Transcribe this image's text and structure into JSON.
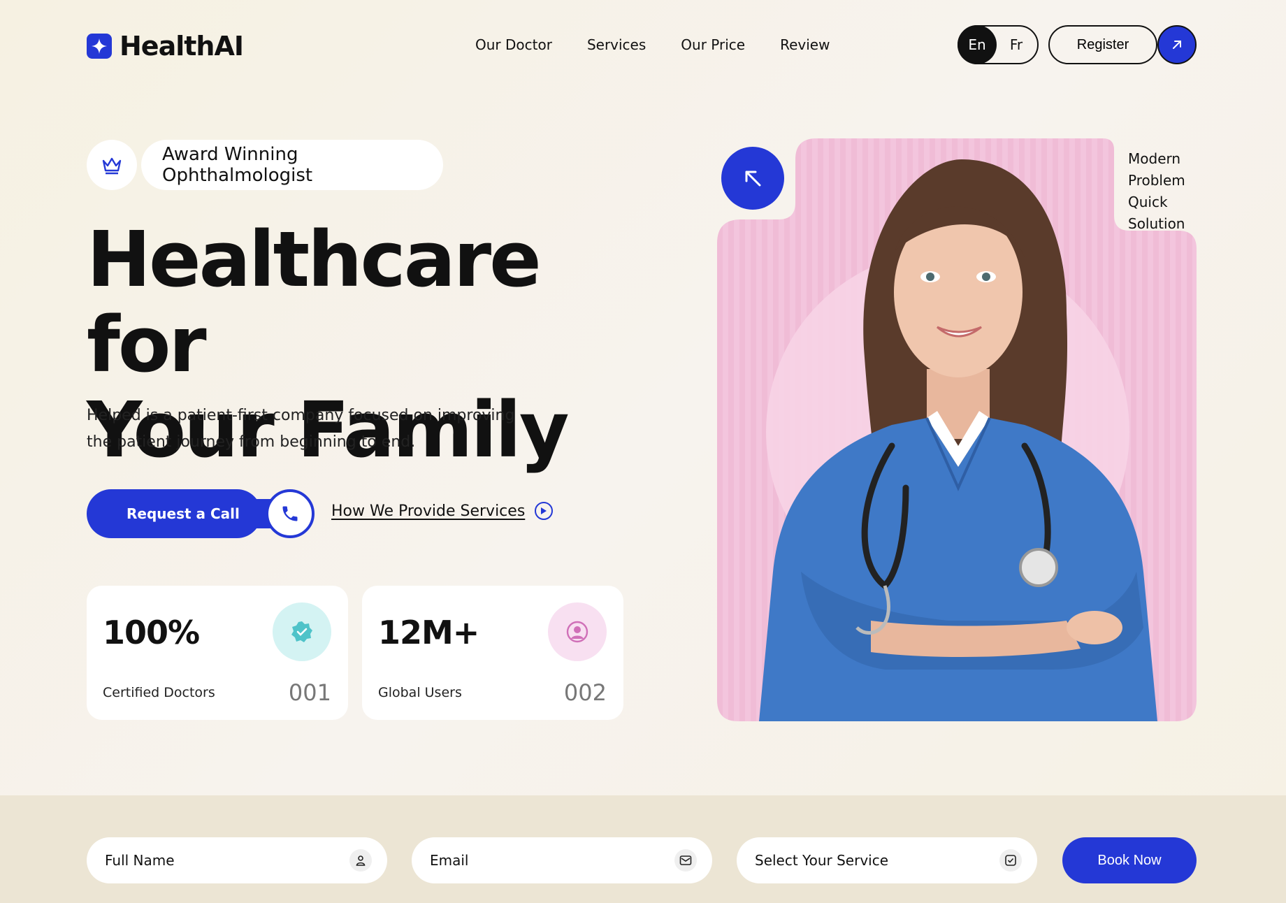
{
  "brand": {
    "name": "HealthAI",
    "accent": "#2438d6"
  },
  "nav": {
    "items": [
      "Our Doctor",
      "Services",
      "Our Price",
      "Review"
    ],
    "lang_en": "En",
    "lang_fr": "Fr",
    "register": "Register"
  },
  "hero": {
    "badge": "Award Winning Ophthalmologist",
    "title_line1": "Healthcare for",
    "title_line2": "Your Family",
    "description": "Helped is a patient-first company focused on improving the patient journey from beginning to end.",
    "cta_label": "Request a Call",
    "secondary_link": "How We Provide Services"
  },
  "stats": [
    {
      "value": "100%",
      "label": "Certified Doctors",
      "index": "001",
      "icon": "verified-badge-icon"
    },
    {
      "value": "12M+",
      "label": "Global Users",
      "index": "002",
      "icon": "user-circle-icon"
    }
  ],
  "tagline": [
    "Modern",
    "Problem",
    "Quick",
    "Solution"
  ],
  "booking": {
    "full_name": "Full Name",
    "email": "Email",
    "service": "Select Your Service",
    "submit": "Book Now"
  }
}
